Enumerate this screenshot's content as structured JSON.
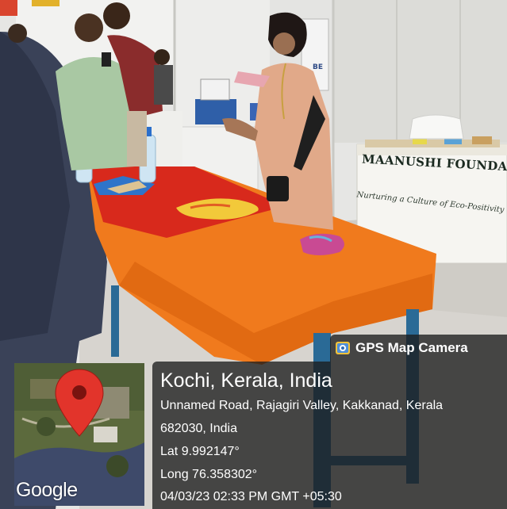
{
  "photo": {
    "banner_text": "MAANUSHI FOUNDATION",
    "banner_tagline": "Nurturing a Culture of Eco-Positivity",
    "stand_letters": "BE"
  },
  "gps_stamp": {
    "app_name": "GPS Map Camera",
    "place": "Kochi, Kerala, India",
    "address_line1": "Unnamed Road, Rajagiri Valley, Kakkanad, Kerala",
    "address_line2": "682030, India",
    "latitude": "Lat 9.992147°",
    "longitude": "Long 76.358302°",
    "datetime": "04/03/23 02:33 PM GMT +05:30",
    "map_provider": "Google",
    "pin_color": "#e2342b"
  }
}
